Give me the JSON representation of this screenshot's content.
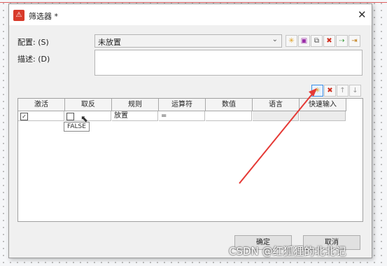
{
  "dialog": {
    "title": "筛选器 *",
    "close_glyph": "✕",
    "app_icon_glyph": "⚠"
  },
  "config": {
    "label": "配置: (S)",
    "value": "未放置",
    "dropdown_glyph": "⌄"
  },
  "description": {
    "label": "描述: (D)",
    "value": ""
  },
  "config_toolbar": [
    {
      "name": "new-config-icon",
      "glyph": "✳",
      "color": "#e0a020"
    },
    {
      "name": "save-config-icon",
      "glyph": "▣",
      "color": "#9b2fa8"
    },
    {
      "name": "copy-config-icon",
      "glyph": "⧉",
      "color": "#555555"
    },
    {
      "name": "delete-config-icon",
      "glyph": "✖",
      "color": "#d03020"
    },
    {
      "name": "import-config-icon",
      "glyph": "⇢",
      "color": "#3a9a3a"
    },
    {
      "name": "export-config-icon",
      "glyph": "⇥",
      "color": "#c07a10"
    }
  ],
  "grid_toolbar": [
    {
      "name": "new-rule-icon",
      "glyph": "✳",
      "color": "#e0a020"
    },
    {
      "name": "delete-rule-icon",
      "glyph": "✖",
      "color": "#d03020"
    },
    {
      "name": "move-up-icon",
      "glyph": "↑",
      "color": "#9a9a9a"
    },
    {
      "name": "move-down-icon",
      "glyph": "↓",
      "color": "#9a9a9a"
    }
  ],
  "grid": {
    "columns": [
      "激活",
      "取反",
      "规则",
      "运算符",
      "数值",
      "语言",
      "快速输入"
    ],
    "rows": [
      {
        "active": true,
        "invert": false,
        "rule": "放置",
        "operator": "=",
        "value": "",
        "language": "",
        "quick_input": ""
      }
    ]
  },
  "tooltip": "FALSE",
  "buttons": {
    "ok": "确定",
    "cancel": "取消"
  },
  "watermark": "CSDN @红狐狸的北北记",
  "colors": {
    "annotation_arrow": "#e53935"
  }
}
